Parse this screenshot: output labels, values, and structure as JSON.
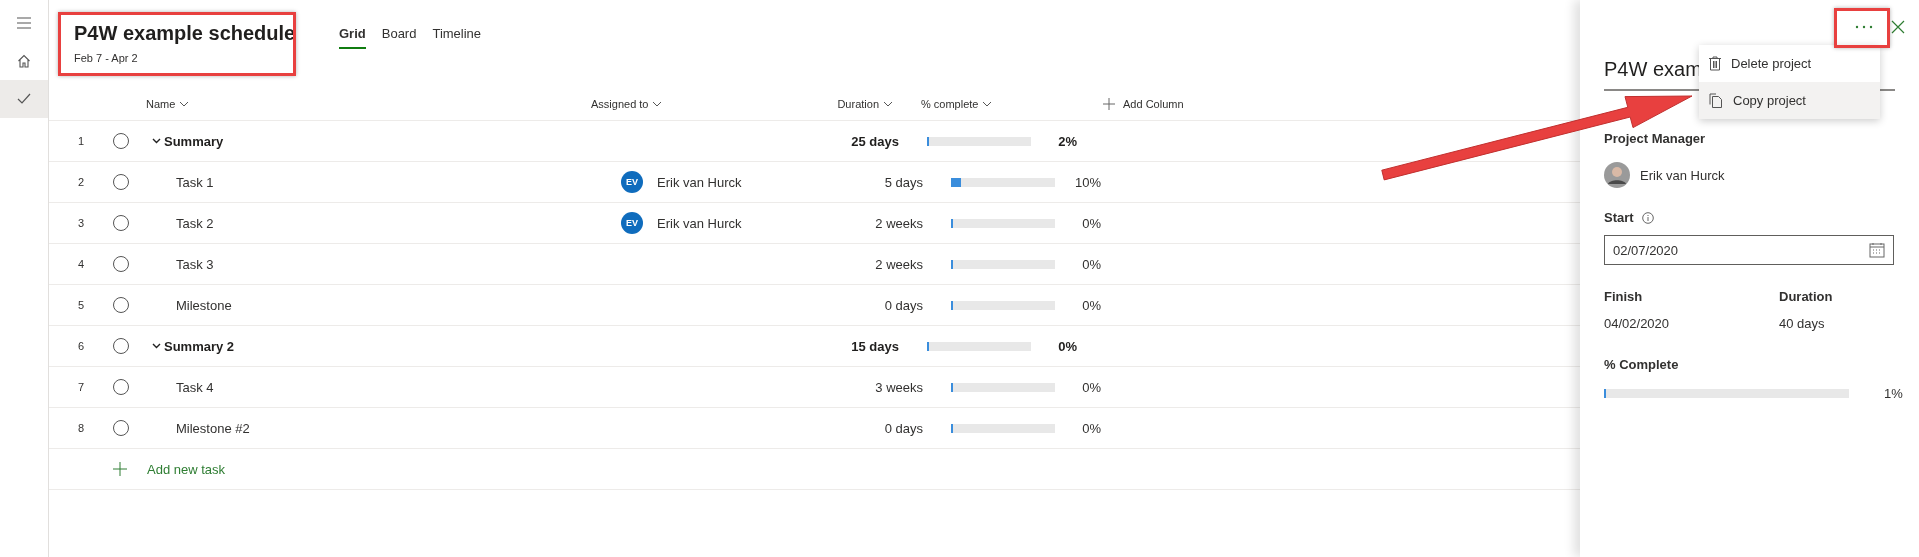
{
  "rail": {
    "items": [
      {
        "kind": "menu",
        "selected": false
      },
      {
        "kind": "home",
        "selected": false
      },
      {
        "kind": "check",
        "selected": true
      }
    ]
  },
  "header": {
    "title": "P4W example schedule",
    "dates": "Feb 7 - Apr 2"
  },
  "tabs": [
    {
      "label": "Grid",
      "selected": true
    },
    {
      "label": "Board",
      "selected": false
    },
    {
      "label": "Timeline",
      "selected": false
    }
  ],
  "columns": {
    "name": "Name",
    "assigned": "Assigned to",
    "duration": "Duration",
    "complete": "% complete",
    "add_column": "Add Column"
  },
  "rows": [
    {
      "number": "1",
      "name": "Summary",
      "kind": "summary",
      "checked": false,
      "expanded": true,
      "duration": "25 days",
      "level": 0.02,
      "reading": "2%"
    },
    {
      "number": "2",
      "name": "Task 1",
      "kind": "task",
      "checked": false,
      "assignee": {
        "initials": "EV",
        "name": "Erik van Hurck"
      },
      "duration": "5 days",
      "level": 0.1,
      "reading": "10%"
    },
    {
      "number": "3",
      "name": "Task 2",
      "kind": "task",
      "checked": false,
      "assignee": {
        "initials": "EV",
        "name": "Erik van Hurck"
      },
      "duration": "2 weeks",
      "level": 0,
      "reading": "0%"
    },
    {
      "number": "4",
      "name": "Task 3",
      "kind": "task",
      "checked": false,
      "duration": "2 weeks",
      "level": 0,
      "reading": "0%"
    },
    {
      "number": "5",
      "name": "Milestone",
      "kind": "task",
      "checked": false,
      "duration": "0 days",
      "level": 0,
      "reading": "0%"
    },
    {
      "number": "6",
      "name": "Summary 2",
      "kind": "summary",
      "checked": false,
      "expanded": true,
      "duration": "15 days",
      "level": 0,
      "reading": "0%"
    },
    {
      "number": "7",
      "name": "Task 4",
      "kind": "task",
      "checked": false,
      "duration": "3 weeks",
      "level": 0,
      "reading": "0%"
    },
    {
      "number": "8",
      "name": "Milestone #2",
      "kind": "task",
      "checked": false,
      "duration": "0 days",
      "level": 0,
      "reading": "0%"
    }
  ],
  "add_task": "Add new task",
  "panel": {
    "title": "P4W exam",
    "menu": [
      {
        "label": "Delete project",
        "kind": "delete",
        "selected": false
      },
      {
        "label": "Copy project",
        "kind": "copy",
        "selected": true
      }
    ],
    "manager_label": "Project Manager",
    "manager_name": "Erik van Hurck",
    "start_label": "Start",
    "start_value": "02/07/2020",
    "finish_label": "Finish",
    "finish_value": "04/02/2020",
    "duration_label": "Duration",
    "duration_value": "40 days",
    "complete_label": "% Complete",
    "level": 0.01,
    "reading": "1%"
  }
}
